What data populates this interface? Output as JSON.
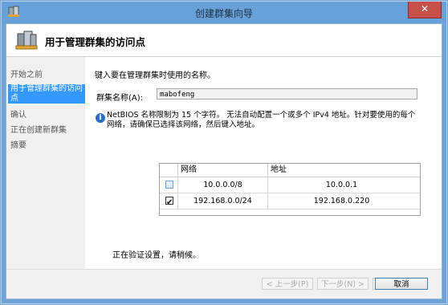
{
  "window": {
    "title": "创建群集向导",
    "close_symbol": "✕"
  },
  "header": {
    "title": "用于管理群集的访问点"
  },
  "nav": {
    "items": [
      {
        "label": "开始之前",
        "active": false
      },
      {
        "label": "用于管理群集的访问点",
        "active": true
      },
      {
        "label": "确认",
        "active": false
      },
      {
        "label": "正在创建新群集",
        "active": false
      },
      {
        "label": "摘要",
        "active": false
      }
    ]
  },
  "content": {
    "instruction": "键入要在管理群集时使用的名称。",
    "name_label": "群集名称(A):",
    "name_value": "mabofeng",
    "info_icon": "i",
    "info_text": "NetBIOS 名称限制为 15 个字符。 无法自动配置一个或多个 IPv4 地址。针对要使用的每个网络，请确保已选择该网络，然后键入地址。",
    "grid": {
      "headers": [
        "网络",
        "地址"
      ],
      "rows": [
        {
          "network": "10.0.0.0/8",
          "address": "10.0.0.1",
          "checked": false
        },
        {
          "network": "192.168.0.0/24",
          "address": "192.168.0.220",
          "checked": true
        }
      ]
    },
    "status": "正在验证设置，请稍候。"
  },
  "footer": {
    "prev_label": "< 上一步(P)",
    "next_label": "下一步(N) >",
    "create_label": "",
    "cancel_label": "取消"
  },
  "colors": {
    "title_bar": "#68a1d9",
    "nav_active": "#3399ff",
    "close_button": "#c7504a"
  }
}
